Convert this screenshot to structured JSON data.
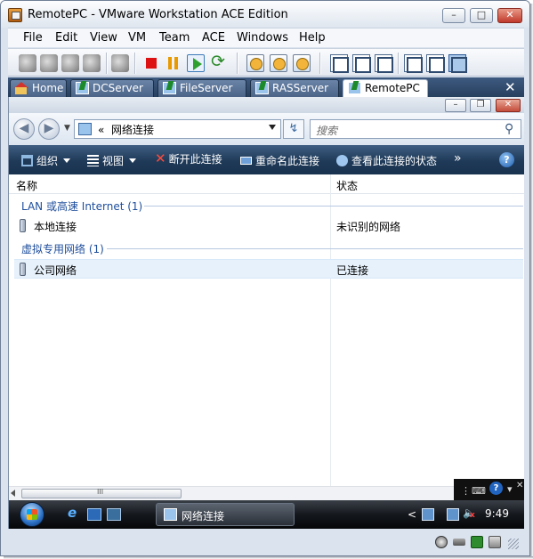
{
  "window": {
    "title": "RemotePC - VMware Workstation ACE Edition",
    "minimize": "–",
    "maximize": "□",
    "close": "✕"
  },
  "menu": [
    "File",
    "Edit",
    "View",
    "VM",
    "Team",
    "ACE",
    "Windows",
    "Help"
  ],
  "tabs": [
    {
      "label": "Home",
      "icon": "home-icon"
    },
    {
      "label": "DCServer",
      "icon": "vm-icon"
    },
    {
      "label": "FileServer",
      "icon": "vm-icon"
    },
    {
      "label": "RASServer",
      "icon": "vm-icon"
    },
    {
      "label": "RemotePC",
      "icon": "vm-icon",
      "active": true
    }
  ],
  "tab_close": "✕",
  "guest": {
    "caption": {
      "minimize": "–",
      "restore": "❐",
      "close": "✕"
    },
    "nav": {
      "back": "◀",
      "forward": "▶",
      "dropdown": "▼"
    },
    "address": {
      "prefix": "«",
      "text": "网络连接"
    },
    "refresh": "↯",
    "search": {
      "placeholder": "搜索"
    },
    "commands": {
      "organize": "组织",
      "view": "视图",
      "disconnect": "断开此连接",
      "rename": "重命名此连接",
      "status": "查看此连接的状态",
      "more": "»",
      "help": "?"
    },
    "columns": {
      "name": "名称",
      "status": "状态"
    },
    "groups": [
      {
        "title": "LAN 或高速 Internet (1)",
        "items": [
          {
            "name": "本地连接",
            "status": "未识别的网络",
            "selected": false
          }
        ]
      },
      {
        "title": "虚拟专用网络 (1)",
        "items": [
          {
            "name": "公司网络",
            "status": "已连接",
            "selected": true
          }
        ]
      }
    ],
    "hscroll_grip": "III",
    "vmbar": {
      "help": "?",
      "close": "✕"
    },
    "taskbar": {
      "ie": "e",
      "task_label": "网络连接",
      "tray_arrow": "<",
      "clock": "9:49",
      "volume": "🔈",
      "muted": "x"
    }
  }
}
